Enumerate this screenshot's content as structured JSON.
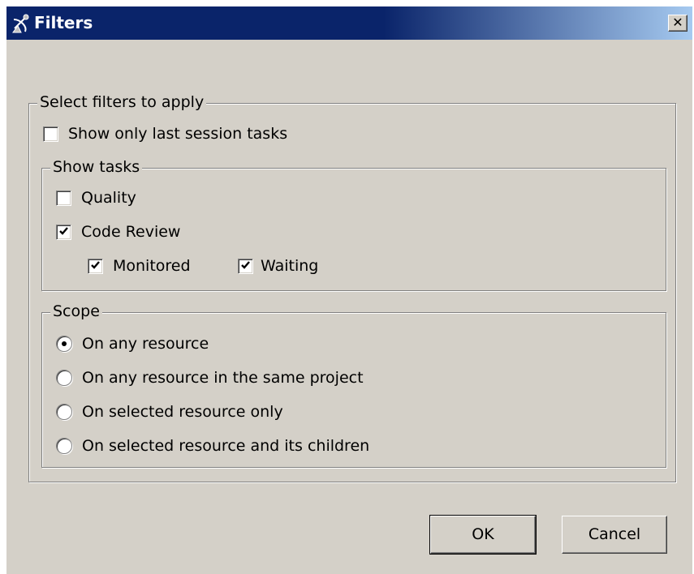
{
  "window": {
    "title": "Filters",
    "close_glyph": "✕",
    "icon": "satellite-dish-icon"
  },
  "filters_group": {
    "legend": "Select filters to apply",
    "last_session": {
      "label": "Show only last session tasks",
      "checked": false
    }
  },
  "show_tasks": {
    "legend": "Show tasks",
    "quality": {
      "label": "Quality",
      "checked": false
    },
    "code_review": {
      "label": "Code Review",
      "checked": true
    },
    "monitored": {
      "label": "Monitored",
      "checked": true
    },
    "waiting": {
      "label": "Waiting",
      "checked": true
    }
  },
  "scope": {
    "legend": "Scope",
    "options": [
      {
        "label": "On any resource",
        "selected": true
      },
      {
        "label": "On any resource in the same project",
        "selected": false
      },
      {
        "label": "On selected resource only",
        "selected": false
      },
      {
        "label": "On selected resource and its children",
        "selected": false
      }
    ]
  },
  "buttons": {
    "ok": "OK",
    "cancel": "Cancel"
  },
  "colors": {
    "dialog_bg": "#d4d0c8",
    "titlebar_start": "#0a246a",
    "titlebar_end": "#a6caf0"
  }
}
